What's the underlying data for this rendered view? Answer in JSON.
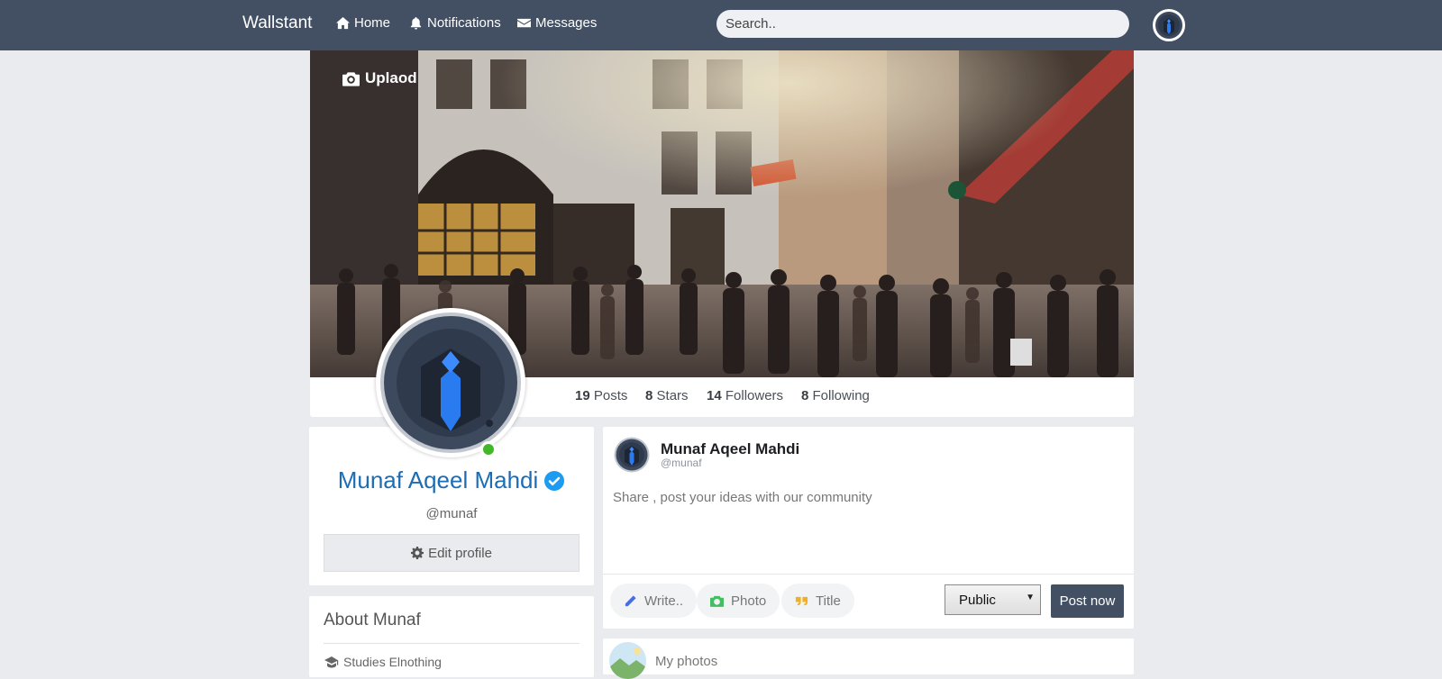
{
  "navbar": {
    "brand": "Wallstant",
    "home_label": "Home",
    "notifications_label": "Notifications",
    "messages_label": "Messages",
    "search_placeholder": "Search.."
  },
  "cover": {
    "upload_label": "Uplaod"
  },
  "stats": [
    {
      "count": "19",
      "label": "Posts"
    },
    {
      "count": "8",
      "label": "Stars"
    },
    {
      "count": "14",
      "label": "Followers"
    },
    {
      "count": "8",
      "label": "Following"
    }
  ],
  "profile": {
    "name": "Munaf Aqeel Mahdi",
    "handle": "@munaf",
    "verified": true,
    "online": true,
    "edit_label": "Edit profile"
  },
  "about": {
    "title": "About Munaf",
    "items": [
      {
        "icon": "graduation-cap-icon",
        "text": "Studies Elnothing"
      }
    ]
  },
  "composer": {
    "name": "Munaf Aqeel Mahdi",
    "handle": "@munaf",
    "placeholder": "Share , post your ideas with our community",
    "write_label": "Write..",
    "photo_label": "Photo",
    "title_label": "Title",
    "privacy_value": "Public",
    "post_label": "Post now"
  },
  "photos": {
    "label": "My photos"
  },
  "colors": {
    "navbar": "#434f63",
    "page_background": "#e9ebee",
    "name_blue": "#1d6db5",
    "verified_blue": "#1d9bf0",
    "online_green": "#42b72a",
    "write_icon": "#4a6ee0",
    "photo_icon": "#45bd62",
    "title_icon": "#f2b01e"
  }
}
